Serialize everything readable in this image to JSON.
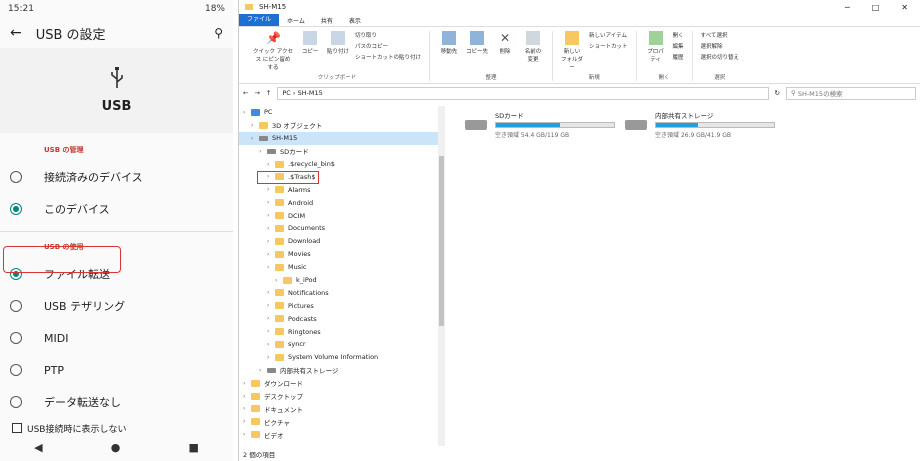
{
  "android": {
    "status_time": "15:21",
    "status_right": "18%",
    "title": "USB の設定",
    "usb_label": "USB",
    "section_manage": "USB の管理",
    "manage_options": [
      "接続済みのデバイス",
      "このデバイス"
    ],
    "section_use": "USB の使用",
    "use_options": [
      "ファイル転送",
      "USB テザリング",
      "MIDI",
      "PTP",
      "データ転送なし"
    ],
    "checkbox_label": "USB接続時に表示しない"
  },
  "explorer": {
    "window_title": "SH-M15",
    "tabs": [
      "ファイル",
      "ホーム",
      "共有",
      "表示"
    ],
    "ribbon": {
      "clipboard": {
        "pin": "クイック アクセス にピン留めする",
        "copy": "コピー",
        "paste": "貼り付け",
        "cut": "切り取り",
        "copy_path": "パスのコピー",
        "paste_shortcut": "ショートカットの貼り付け",
        "group": "クリップボード"
      },
      "organize": {
        "move": "移動先",
        "copy_to": "コピー先",
        "delete": "削除",
        "rename": "名前の 変更",
        "group": "整理"
      },
      "new": {
        "new_folder": "新しい フォルダー",
        "new_item": "新しいアイテム",
        "shortcut": "ショートカット",
        "group": "新規"
      },
      "open": {
        "properties": "プロパティ",
        "open": "開く",
        "edit": "編集",
        "history": "履歴",
        "group": "開く"
      },
      "select": {
        "select_all": "すべて選択",
        "select_none": "選択解除",
        "invert": "選択の切り替え",
        "group": "選択"
      }
    },
    "address": [
      "PC",
      "SH-M15"
    ],
    "search_placeholder": "SH-M15の検索",
    "tree": [
      {
        "label": "PC",
        "level": 0,
        "type": "pc"
      },
      {
        "label": "3D オブジェクト",
        "level": 1,
        "type": "folder"
      },
      {
        "label": "SH-M15",
        "level": 1,
        "type": "drv",
        "selected": true
      },
      {
        "label": "SDカード",
        "level": 2,
        "type": "drv"
      },
      {
        "label": ".$recycle_bin$",
        "level": 3,
        "type": "folder"
      },
      {
        "label": ".$Trash$",
        "level": 3,
        "type": "folder"
      },
      {
        "label": "Alarms",
        "level": 3,
        "type": "folder"
      },
      {
        "label": "Android",
        "level": 3,
        "type": "folder"
      },
      {
        "label": "DCIM",
        "level": 3,
        "type": "folder"
      },
      {
        "label": "Documents",
        "level": 3,
        "type": "folder"
      },
      {
        "label": "Download",
        "level": 3,
        "type": "folder"
      },
      {
        "label": "Movies",
        "level": 3,
        "type": "folder"
      },
      {
        "label": "Music",
        "level": 3,
        "type": "folder"
      },
      {
        "label": "k_iPod",
        "level": 4,
        "type": "folder"
      },
      {
        "label": "Notifications",
        "level": 3,
        "type": "folder"
      },
      {
        "label": "Pictures",
        "level": 3,
        "type": "folder"
      },
      {
        "label": "Podcasts",
        "level": 3,
        "type": "folder"
      },
      {
        "label": "Ringtones",
        "level": 3,
        "type": "folder"
      },
      {
        "label": "syncr",
        "level": 3,
        "type": "folder"
      },
      {
        "label": "System Volume Information",
        "level": 3,
        "type": "folder"
      },
      {
        "label": "内部共有ストレージ",
        "level": 2,
        "type": "drv"
      },
      {
        "label": "ダウンロード",
        "level": 0,
        "type": "folder"
      },
      {
        "label": "デスクトップ",
        "level": 0,
        "type": "folder"
      },
      {
        "label": "ドキュメント",
        "level": 0,
        "type": "folder"
      },
      {
        "label": "ピクチャ",
        "level": 0,
        "type": "folder"
      },
      {
        "label": "ビデオ",
        "level": 0,
        "type": "folder"
      }
    ],
    "drives": [
      {
        "name": "SDカード",
        "free": "空き領域 54.4 GB/119 GB",
        "used_fraction": 0.54
      },
      {
        "name": "内部共有ストレージ",
        "free": "空き領域 26.9 GB/41.9 GB",
        "used_fraction": 0.36
      }
    ],
    "status": "2 個の項目"
  }
}
